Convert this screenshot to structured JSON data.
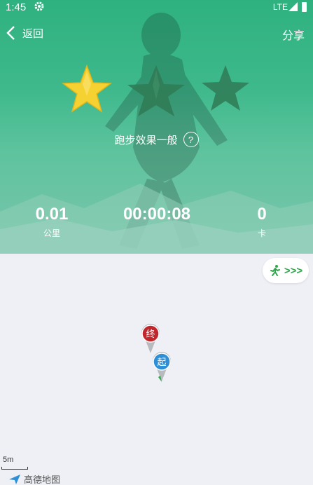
{
  "status": {
    "time": "1:45",
    "network": "LTE"
  },
  "nav": {
    "back_label": "返回",
    "share_label": "分享"
  },
  "rating": {
    "text": "跑步效果一般",
    "help_symbol": "?",
    "stars_filled": 1,
    "stars_total": 3
  },
  "stats": [
    {
      "value": "0.01",
      "unit": "公里"
    },
    {
      "value": "00:00:08",
      "unit": ""
    },
    {
      "value": "0",
      "unit": "卡"
    }
  ],
  "map": {
    "run_button_label": ">>>",
    "end_marker": "终",
    "start_marker": "起",
    "scale_label": "5m",
    "provider": "高德地图"
  },
  "colors": {
    "accent_green": "#2ea84a",
    "star_gold": "#f5d132",
    "header_green": "#3eb98c"
  }
}
